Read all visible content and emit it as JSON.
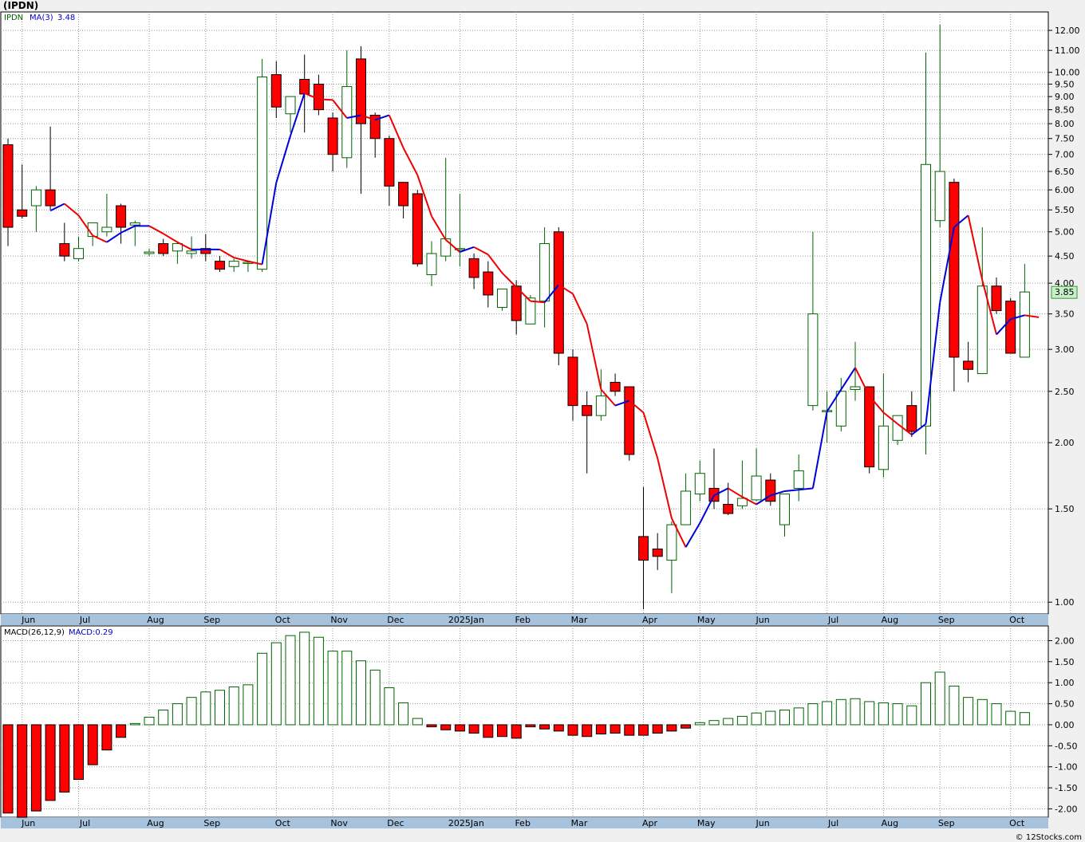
{
  "header": {
    "title": "(IPDN)"
  },
  "footer": {
    "credit": "© 12Stocks.com"
  },
  "chart_data": [
    {
      "type": "candlestick",
      "ticker_label": "IPDN",
      "ma_label": "MA(3)",
      "ma_value_label": "3.48",
      "last_price_label": "3.85",
      "scale": "log",
      "ylim": [
        0.95,
        13.0
      ],
      "y_ticks": [
        "1.00",
        "1.50",
        "2.00",
        "2.50",
        "3.00",
        "3.50",
        "4.00",
        "4.50",
        "5.00",
        "5.50",
        "6.00",
        "6.50",
        "7.00",
        "7.50",
        "8.00",
        "8.50",
        "9.00",
        "9.50",
        "10.00",
        "11.00",
        "12.00"
      ],
      "x_labels": [
        "Jun",
        "Jul",
        "Aug",
        "Sep",
        "Oct",
        "Nov",
        "Dec",
        "2025Jan",
        "Feb",
        "Mar",
        "Apr",
        "May",
        "Jun",
        "Jul",
        "Aug",
        "Sep",
        "Oct"
      ],
      "x_label_week_index": [
        1,
        5,
        10,
        14,
        19,
        23,
        27,
        32,
        36,
        40,
        45,
        49,
        53,
        58,
        62,
        66,
        71
      ],
      "grid": true,
      "candles": [
        [
          7.3,
          7.5,
          4.7,
          5.1
        ],
        [
          5.5,
          6.7,
          5.3,
          5.35
        ],
        [
          5.6,
          6.1,
          5.0,
          6.0
        ],
        [
          6.0,
          7.9,
          5.5,
          5.6
        ],
        [
          4.75,
          5.2,
          4.4,
          4.5
        ],
        [
          4.45,
          4.9,
          4.4,
          4.65
        ],
        [
          4.9,
          5.15,
          4.7,
          5.2
        ],
        [
          5.0,
          5.9,
          4.9,
          5.1
        ],
        [
          5.6,
          5.65,
          4.75,
          5.1
        ],
        [
          5.15,
          5.25,
          4.7,
          5.2
        ],
        [
          4.55,
          4.65,
          4.5,
          4.58
        ],
        [
          4.75,
          4.85,
          4.5,
          4.55
        ],
        [
          4.6,
          4.8,
          4.35,
          4.75
        ],
        [
          4.55,
          4.9,
          4.45,
          4.6
        ],
        [
          4.65,
          4.95,
          4.4,
          4.55
        ],
        [
          4.4,
          4.5,
          4.2,
          4.25
        ],
        [
          4.3,
          4.45,
          4.2,
          4.4
        ],
        [
          4.38,
          4.4,
          4.2,
          4.38
        ],
        [
          4.25,
          10.6,
          4.2,
          9.8
        ],
        [
          9.9,
          10.5,
          8.2,
          8.6
        ],
        [
          8.35,
          9.0,
          7.7,
          9.0
        ],
        [
          9.7,
          10.8,
          7.7,
          9.1
        ],
        [
          9.5,
          9.9,
          8.3,
          8.5
        ],
        [
          8.2,
          8.4,
          6.5,
          7.0
        ],
        [
          6.9,
          11.0,
          6.6,
          9.4
        ],
        [
          10.6,
          11.2,
          5.9,
          8.0
        ],
        [
          8.3,
          8.4,
          6.9,
          7.5
        ],
        [
          7.5,
          7.6,
          5.6,
          6.1
        ],
        [
          6.2,
          6.2,
          5.3,
          5.6
        ],
        [
          5.9,
          6.0,
          4.3,
          4.35
        ],
        [
          4.15,
          4.8,
          3.95,
          4.55
        ],
        [
          4.5,
          6.9,
          4.4,
          4.85
        ],
        [
          4.65,
          5.9,
          4.3,
          4.65
        ],
        [
          4.45,
          4.55,
          3.9,
          4.1
        ],
        [
          4.2,
          4.4,
          3.6,
          3.8
        ],
        [
          3.6,
          3.9,
          3.55,
          3.9
        ],
        [
          3.95,
          4.05,
          3.2,
          3.4
        ],
        [
          3.35,
          3.8,
          3.35,
          3.75
        ],
        [
          3.7,
          5.1,
          3.3,
          4.75
        ],
        [
          5.0,
          5.1,
          2.8,
          2.95
        ],
        [
          2.9,
          3.0,
          2.2,
          2.35
        ],
        [
          2.35,
          2.5,
          1.75,
          2.25
        ],
        [
          2.25,
          2.75,
          2.2,
          2.45
        ],
        [
          2.6,
          2.7,
          2.45,
          2.5
        ],
        [
          2.55,
          2.55,
          1.85,
          1.9
        ],
        [
          1.33,
          1.65,
          0.97,
          1.2
        ],
        [
          1.26,
          1.35,
          1.15,
          1.22
        ],
        [
          1.2,
          1.42,
          1.04,
          1.4
        ],
        [
          1.4,
          1.75,
          1.4,
          1.62
        ],
        [
          1.6,
          1.85,
          1.55,
          1.75
        ],
        [
          1.64,
          1.95,
          1.5,
          1.55
        ],
        [
          1.53,
          1.68,
          1.46,
          1.47
        ],
        [
          1.52,
          1.85,
          1.5,
          1.57
        ],
        [
          1.56,
          1.95,
          1.55,
          1.73
        ],
        [
          1.7,
          1.75,
          1.52,
          1.55
        ],
        [
          1.4,
          1.6,
          1.33,
          1.6
        ],
        [
          1.64,
          1.9,
          1.55,
          1.77
        ],
        [
          2.35,
          5.0,
          2.3,
          3.5
        ],
        [
          2.3,
          2.5,
          2.0,
          2.3
        ],
        [
          2.15,
          2.65,
          2.1,
          2.5
        ],
        [
          2.52,
          3.1,
          2.4,
          2.55
        ],
        [
          2.55,
          2.55,
          1.75,
          1.8
        ],
        [
          1.78,
          2.7,
          1.72,
          2.15
        ],
        [
          2.02,
          2.25,
          1.98,
          2.25
        ],
        [
          2.35,
          2.5,
          2.05,
          2.1
        ],
        [
          2.15,
          10.9,
          1.9,
          6.7
        ],
        [
          5.25,
          12.3,
          5.1,
          6.5
        ],
        [
          6.2,
          6.3,
          2.5,
          2.9
        ],
        [
          2.85,
          3.1,
          2.6,
          2.75
        ],
        [
          2.7,
          5.1,
          2.7,
          3.95
        ],
        [
          3.95,
          4.1,
          3.5,
          3.55
        ],
        [
          3.7,
          3.75,
          2.95,
          2.95
        ],
        [
          2.9,
          4.35,
          2.9,
          3.85
        ]
      ],
      "ma3": [
        null,
        null,
        5.48,
        5.65,
        5.37,
        4.92,
        4.78,
        4.98,
        5.13,
        5.13,
        4.96,
        4.78,
        4.63,
        4.63,
        4.63,
        4.47,
        4.4,
        4.34,
        6.19,
        7.59,
        9.13,
        8.9,
        8.87,
        8.2,
        8.3,
        8.13,
        8.3,
        7.2,
        6.4,
        5.35,
        4.83,
        4.58,
        4.68,
        4.53,
        4.18,
        3.93,
        3.7,
        3.68,
        3.97,
        3.82,
        3.35,
        2.52,
        2.35,
        2.4,
        2.28,
        1.87,
        1.44,
        1.27,
        1.41,
        1.59,
        1.64,
        1.58,
        1.53,
        1.59,
        1.62,
        1.63,
        1.64,
        2.29,
        2.52,
        2.77,
        2.45,
        2.28,
        2.17,
        2.07,
        2.17,
        3.68,
        5.1,
        5.37,
        4.05,
        3.2,
        3.42,
        3.48,
        3.45
      ],
      "macd_label": "MACD(26,12,9)",
      "macd_value_label": "MACD:0.29",
      "macd_ylim": [
        -2.2,
        2.35
      ],
      "macd_ticks": [
        "2.00",
        "1.50",
        "1.00",
        "0.50",
        "0.00",
        "-0.50",
        "-1.00",
        "-1.50",
        "-2.00"
      ],
      "macd": [
        -2.1,
        -2.2,
        -2.05,
        -1.8,
        -1.6,
        -1.3,
        -0.95,
        -0.6,
        -0.3,
        0.03,
        0.18,
        0.35,
        0.5,
        0.65,
        0.78,
        0.82,
        0.9,
        0.95,
        1.7,
        1.95,
        2.12,
        2.2,
        2.08,
        1.75,
        1.75,
        1.52,
        1.3,
        0.88,
        0.52,
        0.15,
        -0.05,
        -0.12,
        -0.15,
        -0.2,
        -0.3,
        -0.28,
        -0.32,
        -0.05,
        -0.1,
        -0.15,
        -0.25,
        -0.28,
        -0.22,
        -0.2,
        -0.25,
        -0.25,
        -0.2,
        -0.15,
        -0.08,
        0.05,
        0.1,
        0.15,
        0.2,
        0.28,
        0.32,
        0.35,
        0.4,
        0.5,
        0.55,
        0.6,
        0.62,
        0.55,
        0.52,
        0.5,
        0.45,
        1.0,
        1.25,
        0.92,
        0.65,
        0.6,
        0.5,
        0.32,
        0.29
      ]
    }
  ]
}
